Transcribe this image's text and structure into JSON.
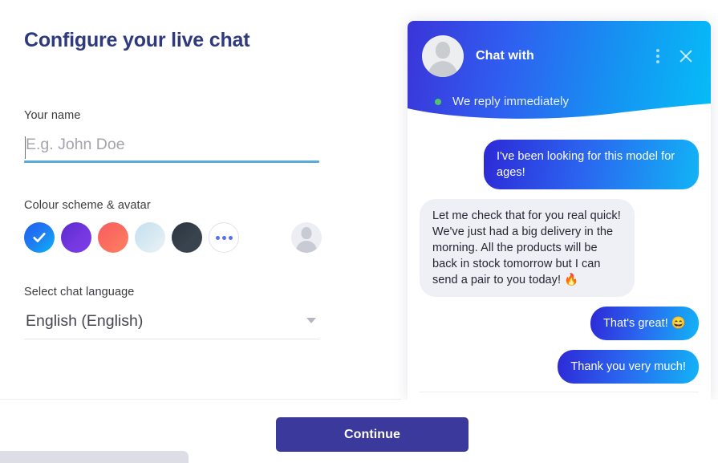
{
  "page": {
    "title": "Configure your live chat"
  },
  "form": {
    "name_field": {
      "label": "Your name",
      "value": "",
      "placeholder": "E.g. John Doe"
    },
    "colour_field": {
      "label": "Colour scheme & avatar",
      "swatches": [
        {
          "name": "blue",
          "color": "#1b6ef3",
          "gradient": "linear-gradient(135deg, #1f5cf0 0%, #1f7ef2 50%, #07b6f5 100%)",
          "selected": true
        },
        {
          "name": "purple",
          "color": "#6b2fd6",
          "gradient": "linear-gradient(135deg, #5b29c9 0%, #7438e0 55%, #7b3ce6 100%)",
          "selected": false
        },
        {
          "name": "coral",
          "color": "#f9665e",
          "gradient": "linear-gradient(135deg, #f75c63 0%, #fb6f5e 55%, #fd8463 100%)",
          "selected": false
        },
        {
          "name": "pale-blue",
          "color": "#d4e7f0",
          "gradient": "linear-gradient(135deg, #c5dfee 0%, #d6e9f2 50%, #edf2f5 100%)",
          "selected": false
        },
        {
          "name": "dark",
          "color": "#333c46",
          "gradient": "linear-gradient(135deg, #2b3540 0%, #39434e 60%, #39434e 100%)",
          "selected": false
        }
      ],
      "more_label": "more-colours",
      "check_icon": "check-icon",
      "avatar_icon": "avatar-placeholder-icon"
    },
    "language_field": {
      "label": "Select chat language",
      "value": "English (English)",
      "chevron_icon": "chevron-down-icon"
    }
  },
  "chat_widget": {
    "header": {
      "avatar_icon": "agent-avatar-icon",
      "title": "Chat with",
      "menu_icon": "dots-vertical-icon",
      "close_icon": "close-icon",
      "status_text": "We reply immediately",
      "status_dot_color": "#4fc56b"
    },
    "messages": [
      {
        "direction": "out",
        "text": "I've been looking for this model for ages!"
      },
      {
        "direction": "in",
        "text": "Let me check that for you real quick! We've just had a big delivery in the morning. All the products will be back in stock tomorrow but I can send a pair to you today! 🔥"
      },
      {
        "direction": "out",
        "text": "That's great! 😄"
      },
      {
        "direction": "out",
        "text": "Thank you very much!"
      }
    ]
  },
  "footer": {
    "continue_label": "Continue"
  },
  "colors": {
    "title": "#2f3a7e",
    "accent_button": "#3b3a9c",
    "input_underline": "#5aabdb",
    "bubble_in_bg": "#eff0f5",
    "header_gradient_start": "#3b34d8",
    "header_gradient_end": "#06bdf7"
  }
}
